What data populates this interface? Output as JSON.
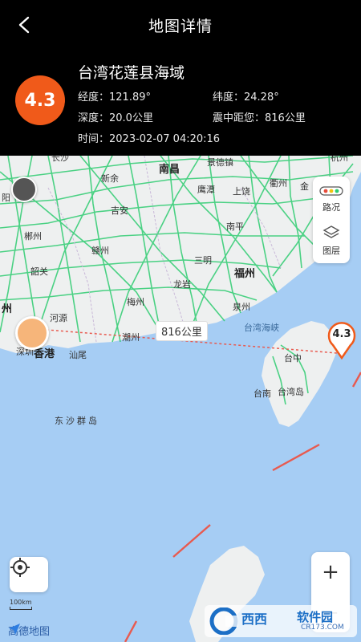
{
  "header": {
    "title": "地图详情",
    "back_icon": "chevron-left-icon"
  },
  "quake": {
    "magnitude": "4.3",
    "place": "台湾花莲县海域",
    "longitude": "经度：121.89°",
    "latitude": "纬度：24.28°",
    "depth": "深度：20.0公里",
    "distance_from_me": "震中距您：816公里",
    "time": "时间：2023-02-07 04:20:16"
  },
  "map": {
    "distance_label": "816公里",
    "marker_magnitude": "4.3",
    "labels": {
      "changsha": "长沙",
      "nanchang": "南昌",
      "jingdezhen": "景德镇",
      "quzhou": "衢州",
      "jin": "金",
      "hangzhou": "杭州",
      "xinyu": "新余",
      "yingtan": "鹰潭",
      "shangrao": "上饶",
      "yang": "阳",
      "ji_an": "吉安",
      "chenzhou": "郴州",
      "ganzhou": "赣州",
      "nanping": "南平",
      "sanming": "三明",
      "shaoguan": "韶关",
      "fuzhou": "福州",
      "longyan": "龙岩",
      "zhou": "州",
      "meizhou": "梅州",
      "quanzhou": "泉州",
      "heyuan": "河源",
      "chaozhou": "潮州",
      "xiang": "香港",
      "shenzhen": "深圳",
      "shanwei": "汕尾",
      "taiwan_strait": "台湾海峡",
      "taizhong": "台中",
      "tainan": "台南",
      "taiwan_island": "台湾岛",
      "dongsha": "东沙群岛"
    },
    "controls": {
      "traffic_label": "路况",
      "traffic_icon": "traffic-light-icon",
      "layers_label": "图层",
      "layers_icon": "layers-icon",
      "zoom_in": "+",
      "zoom_out": "—",
      "locate_icon": "locate-icon"
    },
    "scale": "100km",
    "logo": "高德地图"
  },
  "watermark": {
    "name": "西西",
    "suffix": "软件园",
    "url": "CR173.COM"
  },
  "colors": {
    "badge": "#f05a1a",
    "road": "#2ecc71",
    "water": "#a6cdf4",
    "land": "#eef0f0"
  }
}
